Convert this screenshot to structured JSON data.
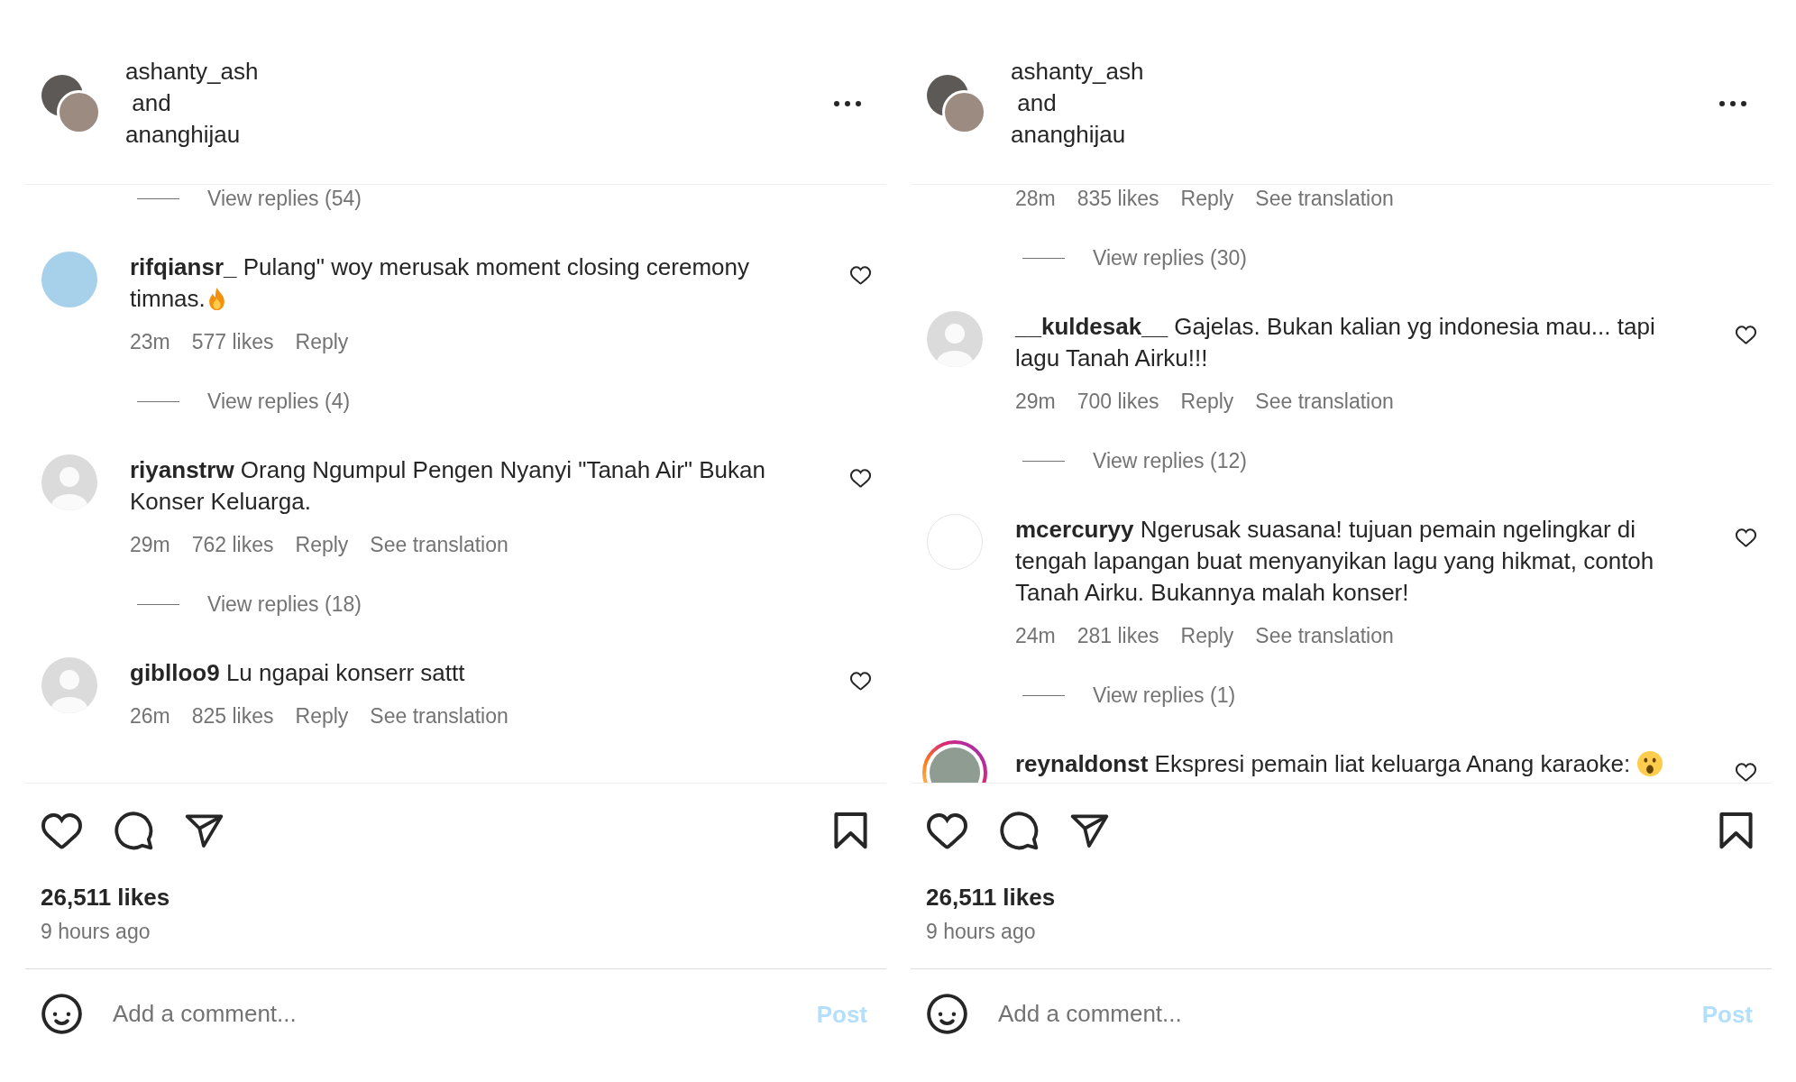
{
  "posts": [
    {
      "header": {
        "owner": "ashanty_ash",
        "joiner": " and",
        "collaborator": "ananghijau"
      },
      "comments": [
        {
          "replies_label": "View replies (54)"
        },
        {
          "avatar": {
            "kind": "photo"
          },
          "username": "rifqiansr_",
          "text": "Pulang\" woy merusak moment closing ceremony timnas.",
          "emoji": {
            "kind": "fire"
          },
          "time": "23m",
          "likes": "577 likes",
          "reply": "Reply",
          "replies_label": "View replies (4)"
        },
        {
          "avatar": {
            "kind": "default"
          },
          "username": "riyanstrw",
          "text": "Orang Ngumpul Pengen Nyanyi \"Tanah Air\" Bukan Konser Keluarga.",
          "time": "29m",
          "likes": "762 likes",
          "reply": "Reply",
          "translation": "See translation",
          "replies_label": "View replies (18)"
        },
        {
          "avatar": {
            "kind": "default"
          },
          "username": "giblloo9",
          "text": "Lu ngapai konserr sattt",
          "time": "26m",
          "likes": "825 likes",
          "reply": "Reply",
          "translation": "See translation"
        }
      ],
      "likes": "26,511 likes",
      "time": "9 hours ago",
      "comment_box": {
        "placeholder": "Add a comment...",
        "post_label": "Post",
        "post_disabled": true
      }
    },
    {
      "header": {
        "owner": "ashanty_ash",
        "joiner": " and",
        "collaborator": "ananghijau"
      },
      "comments": [
        {
          "time": "28m",
          "likes": "835 likes",
          "reply": "Reply",
          "translation": "See translation",
          "replies_label": "View replies (30)"
        },
        {
          "avatar": {
            "kind": "default"
          },
          "username": "__kuldesak__",
          "text": "Gajelas. Bukan kalian yg indonesia mau... tapi lagu Tanah Airku!!!",
          "time": "29m",
          "likes": "700 likes",
          "reply": "Reply",
          "translation": "See translation",
          "replies_label": "View replies (12)"
        },
        {
          "avatar": {
            "kind": "blank"
          },
          "username": "mcercuryy",
          "text": "Ngerusak suasana! tujuan pemain ngelingkar di tengah lapangan buat menyanyikan lagu yang hikmat, contoh Tanah Airku. Bukannya malah konser!",
          "time": "24m",
          "likes": "281 likes",
          "reply": "Reply",
          "translation": "See translation",
          "replies_label": "View replies (1)"
        },
        {
          "avatar": {
            "kind": "story"
          },
          "username": "reynaldonst",
          "text": "Ekspresi pemain liat keluarga Anang karaoke:",
          "emoji": {
            "kind": "surprised"
          }
        }
      ],
      "likes": "26,511 likes",
      "time": "9 hours ago",
      "comment_box": {
        "placeholder": "Add a comment...",
        "post_label": "Post",
        "post_disabled": true
      }
    }
  ]
}
